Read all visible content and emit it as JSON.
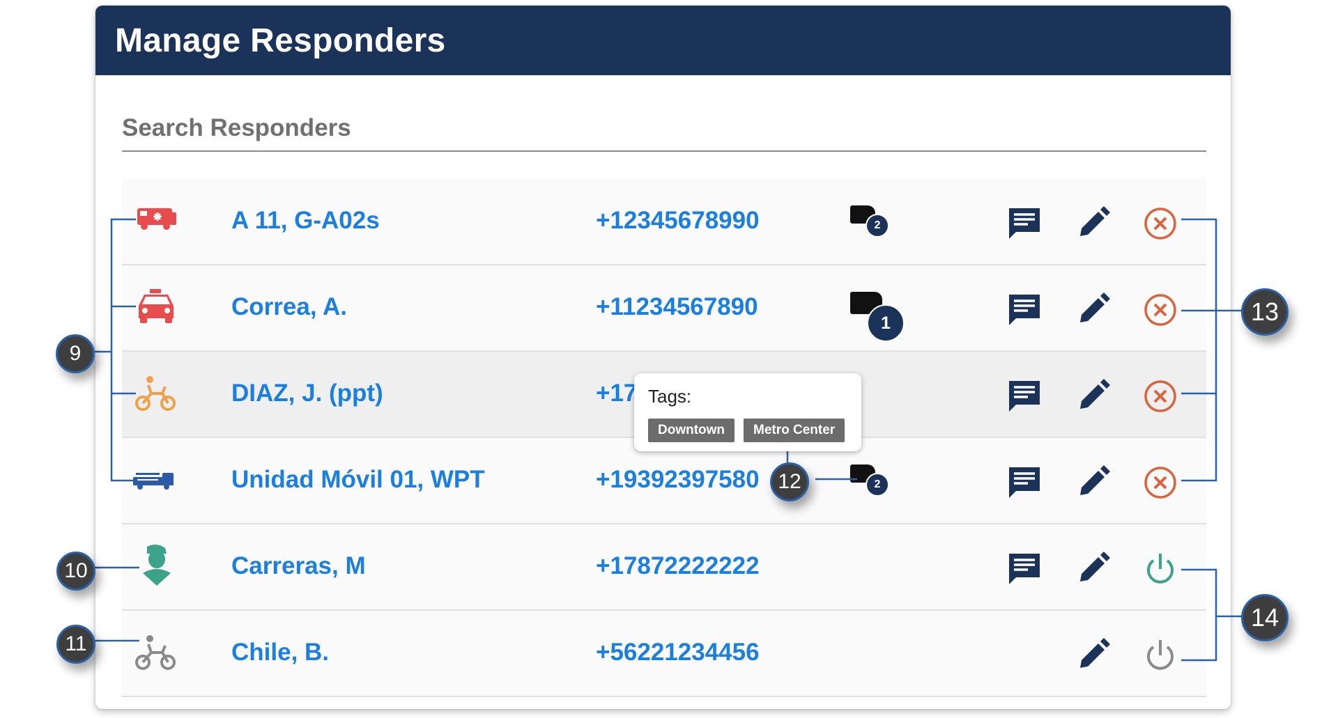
{
  "header": {
    "title": "Manage Responders"
  },
  "search": {
    "placeholder": "Search Responders"
  },
  "responders": [
    {
      "icon": "ambulance-icon",
      "icon_color": "#e84c4c",
      "name": "A 11, G-A02s",
      "phone": "+12345678990",
      "tag_count": "2",
      "status": "remove"
    },
    {
      "icon": "car-icon",
      "icon_color": "#e84c4c",
      "name": "Correa, A.",
      "phone": "+11234567890",
      "tag_count": "1",
      "status": "remove"
    },
    {
      "icon": "motorcycle-icon",
      "icon_color": "#f0a048",
      "name": "DIAZ, J. (ppt)",
      "phone": "+17",
      "tag_count": "",
      "status": "remove"
    },
    {
      "icon": "fire-truck-icon",
      "icon_color": "#2a5aa8",
      "name": "Unidad Móvil 01, WPT",
      "phone": "+19392397580",
      "tag_count": "2",
      "status": "remove"
    },
    {
      "icon": "person-icon",
      "icon_color": "#3aa389",
      "name": "Carreras, M",
      "phone": "+17872222222",
      "tag_count": "",
      "status": "power-on"
    },
    {
      "icon": "motorcycle-icon",
      "icon_color": "#8a8a8a",
      "name": "Chile, B.",
      "phone": "+56221234456",
      "tag_count": "",
      "status": "power-off"
    }
  ],
  "tooltip": {
    "title": "Tags:",
    "tags": [
      "Downtown",
      "Metro Center"
    ]
  },
  "callouts": [
    "9",
    "10",
    "11",
    "12",
    "13",
    "14"
  ],
  "colors": {
    "header": "#1c3359",
    "link": "#1a7fe0",
    "remove": "#d9653f",
    "active": "#3aa389",
    "inactive": "#8a8a8a"
  }
}
